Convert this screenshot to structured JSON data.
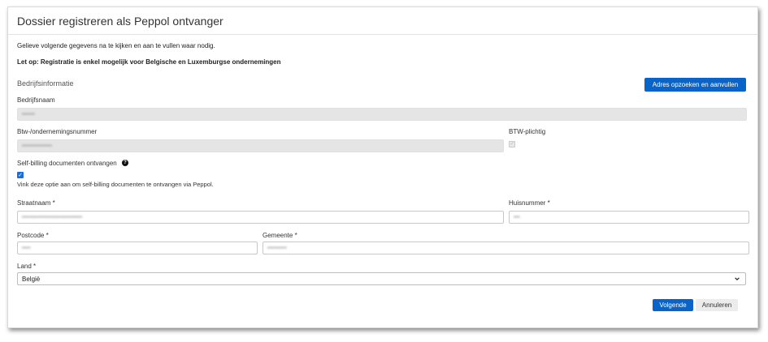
{
  "dialog": {
    "title": "Dossier registreren als Peppol ontvanger",
    "intro": "Gelieve volgende gegevens na te kijken en aan te vullen waar nodig.",
    "notice": "Let op: Registratie is enkel mogelijk voor Belgische en Luxemburgse ondernemingen",
    "section_title": "Bedrijfsinformatie",
    "lookup_button": "Adres opzoeken en aanvullen"
  },
  "fields": {
    "company_name": {
      "label": "Bedrijfsnaam",
      "value": "••••••"
    },
    "vat_number": {
      "label": "Btw-/ondernemingsnummer",
      "value": "••••••••••••••"
    },
    "vat_liable": {
      "label": "BTW-plichtig",
      "checked": true,
      "disabled": true
    },
    "self_billing": {
      "label": "Self-billing documenten ontvangen",
      "help_icon": "question-circle-icon",
      "checked": true,
      "hint": "Vink deze optie aan om self-billing documenten te ontvangen via Peppol."
    },
    "street": {
      "label": "Straatnaam *",
      "value": "••••••••••••••••••••••••••••"
    },
    "house_number": {
      "label": "Huisnummer *",
      "value": "•••"
    },
    "postcode": {
      "label": "Postcode *",
      "value": "••••"
    },
    "municipality": {
      "label": "Gemeente *",
      "value": "•••••••••"
    },
    "country": {
      "label": "Land *",
      "value": "België"
    }
  },
  "footer": {
    "next_button": "Volgende",
    "cancel_button": "Annuleren"
  },
  "colors": {
    "primary": "#0a63c6",
    "disabled_field": "#e5e5e5"
  }
}
